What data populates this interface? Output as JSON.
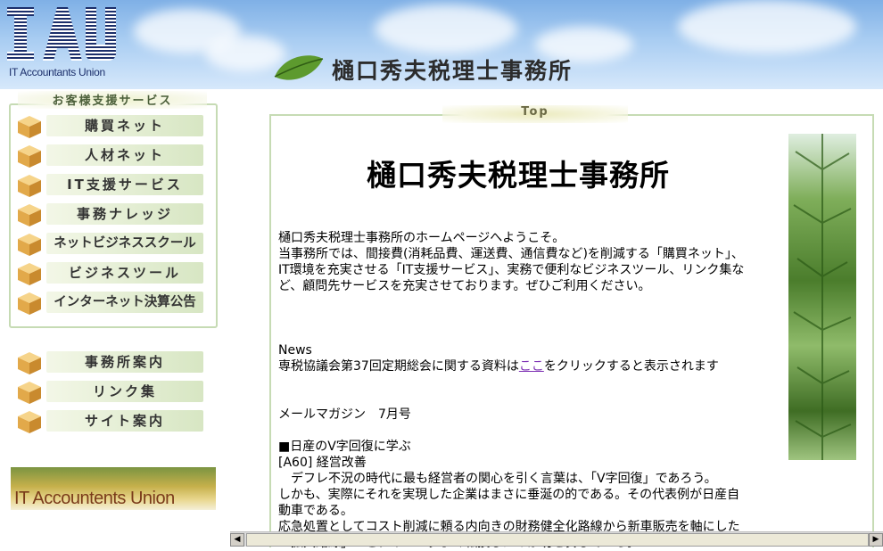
{
  "header": {
    "logo_text": "IT Accountants Union",
    "office_name": "樋口秀夫税理士事務所"
  },
  "sidebar": {
    "service_heading": "お客様支援サービス",
    "service_items": [
      {
        "label": "購買ネット"
      },
      {
        "label": "人材ネット"
      },
      {
        "label": "IT支援サービス"
      },
      {
        "label": "事務ナレッジ"
      },
      {
        "label": "ネットビジネススクール"
      },
      {
        "label": "ビジネスツール"
      },
      {
        "label": "インターネット決算公告"
      }
    ],
    "info_items": [
      {
        "label": "事務所案内"
      },
      {
        "label": "リンク集"
      },
      {
        "label": "サイト案内"
      }
    ],
    "banner_text": "IT Accountents Union"
  },
  "main": {
    "tab_label": "Top",
    "title": "樋口秀夫税理士事務所",
    "welcome_lines": [
      "樋口秀夫税理士事務所のホームページへようこそ。",
      "当事務所では、間接費(消耗品費、運送費、通信費など)を削減する「購買ネット」、",
      "IT環境を充実させる「IT支援サービス」、実務で便利なビジネスツール、リンク集な",
      "ど、顧問先サービスを充実させております。ぜひご利用ください。"
    ],
    "news_label": "News",
    "news_before": "専税協議会第37回定期総会に関する資料は",
    "news_link": "ここ",
    "news_after": "をクリックすると表示されます",
    "magazine": "メールマガジン　7月号",
    "article_heading": "■日産のV字回復に学ぶ",
    "article_code": "[A60] 経営改善",
    "article_lines": [
      "　デフレ不況の時代に最も経営者の関心を引く言葉は、「V字回復」であろう。",
      "しかも、実際にそれを実現した企業はまさに垂涎の的である。その代表例が日産自",
      "動車である。",
      "応急処置としてコスト削減に頼る内向きの財務健全化路線から新車販売を軸にした",
      "「拡大路線」へとタイミングよく転換したのが功を奏している。"
    ]
  },
  "colors": {
    "frame_border": "#c6dbb4",
    "link": "#7c2fb3"
  }
}
